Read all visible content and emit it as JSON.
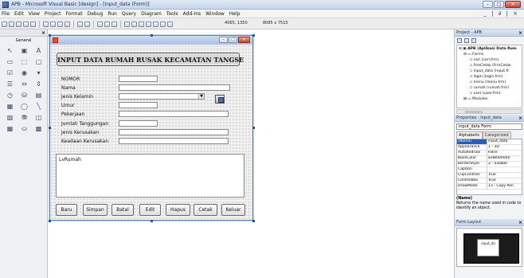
{
  "window": {
    "title": "APB - Microsoft Visual Basic [design] - [input_data (Form)]",
    "menu_right": "_ | ∂ | ×"
  },
  "menu": [
    "File",
    "Edit",
    "View",
    "Project",
    "Format",
    "Debug",
    "Run",
    "Query",
    "Diagram",
    "Tools",
    "Add-Ins",
    "Window",
    "Help"
  ],
  "toolbar": {
    "position": "4065, 1350",
    "size": "8085 x 7515"
  },
  "toolbox": {
    "title": "General",
    "tools": [
      "pointer-icon",
      "picturebox-icon",
      "label-icon",
      "textbox-icon",
      "frame-icon",
      "commandbutton-icon",
      "checkbox-icon",
      "optionbutton-icon",
      "combobox-icon",
      "listbox-icon",
      "hscroll-icon",
      "vscroll-icon",
      "timer-icon",
      "drivelist-icon",
      "dirlist-icon",
      "filelist-icon",
      "shape-icon",
      "line-icon",
      "image-icon",
      "data-icon",
      "ole-icon",
      "calendar-icon",
      "ado-icon",
      "grid-icon"
    ]
  },
  "form": {
    "header": "INPUT DATA RUMAH RUSAK KECAMATAN TANGSE",
    "fields": [
      {
        "label": "NOMOR"
      },
      {
        "label": "Nama"
      },
      {
        "label": "Jenis Kelamin"
      },
      {
        "label": "Umur"
      },
      {
        "label": "Pekerjaan"
      },
      {
        "label": "Jumlah Tanggungan"
      },
      {
        "label": "Jenis Kerusakan"
      },
      {
        "label": "Keadaan Kerusakan"
      }
    ],
    "listview_label": "LvRumah",
    "buttons": [
      "Baru",
      "Simpan",
      "Batal",
      "Edit",
      "Hapus",
      "Cetak",
      "Keluar"
    ]
  },
  "project": {
    "title": "Project - APB",
    "tree": [
      {
        "text": "APB (Aplikasi Data Rum"
      },
      {
        "text": "Forms"
      },
      {
        "text": "cari (cari.frm)"
      },
      {
        "text": "FrmCetak (FrmCetak"
      },
      {
        "text": "input_data (input.fr"
      },
      {
        "text": "login (login.frm)"
      },
      {
        "text": "menu (menu.frm)"
      },
      {
        "text": "rumah (rumah.frm)"
      },
      {
        "text": "user (user.frm)"
      },
      {
        "text": "Modules"
      }
    ]
  },
  "properties": {
    "title": "Properties - input_data",
    "object": "input_data  Form",
    "tabs": [
      "Alphabetic",
      "Categorized"
    ],
    "rows": [
      {
        "name": "(Name)",
        "value": "input_data"
      },
      {
        "name": "Appearance",
        "value": "1 - 3D"
      },
      {
        "name": "AutoRedraw",
        "value": "False"
      },
      {
        "name": "BackColor",
        "value": "&H8000000"
      },
      {
        "name": "BorderStyle",
        "value": "2 - Sizable"
      },
      {
        "name": "Caption",
        "value": ""
      },
      {
        "name": "ClipControls",
        "value": "True"
      },
      {
        "name": "ControlBox",
        "value": "True"
      },
      {
        "name": "DrawMode",
        "value": "13 - Copy Pen"
      }
    ],
    "desc_title": "(Name)",
    "desc_text": "Returns the name used in code to identify an object."
  },
  "form_layout": {
    "title": "Form Layout",
    "form_label": "input_da"
  }
}
